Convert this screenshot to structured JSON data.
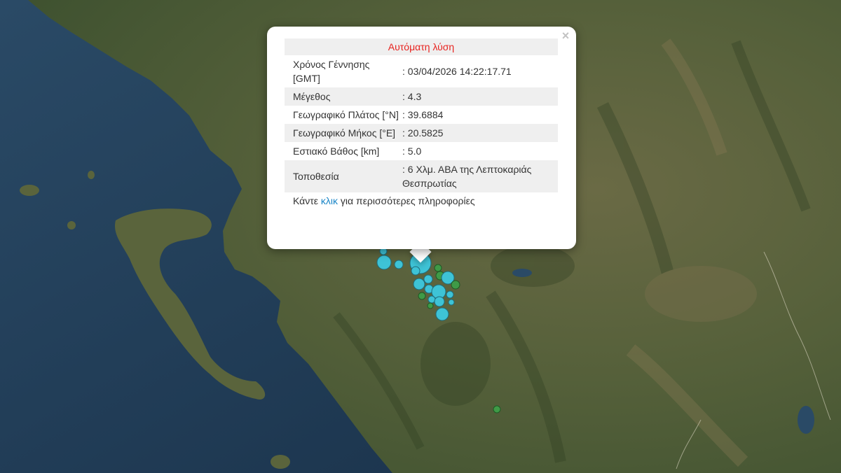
{
  "popup": {
    "close_symbol": "×",
    "title": "Αυτόματη λύση",
    "rows": [
      {
        "label": "Χρόνος Γέννησης [GMT]",
        "value": ": 03/04/2026 14:22:17.71"
      },
      {
        "label": "Μέγεθος",
        "value": ": 4.3"
      },
      {
        "label": "Γεωγραφικό Πλάτος [°N]",
        "value": ": 39.6884"
      },
      {
        "label": "Γεωγραφικό Μήκος [°E]",
        "value": ": 20.5825"
      },
      {
        "label": "Εστιακό Βάθος [km]",
        "value": ": 5.0"
      },
      {
        "label": "Τοποθεσία",
        "value": ": 6 Χλμ. ΑΒΑ της Λεπτοκαριάς Θεσπρωτίας"
      }
    ],
    "more_prefix": "Κάντε ",
    "more_link": "κλικ",
    "more_suffix": " για περισσότερες πληροφορίες"
  },
  "colors": {
    "sea": "#1f3a55",
    "land": "#56603c",
    "quake_recent": "#3ec3d6",
    "quake_older": "#3f9a47",
    "title_red": "#e8231f",
    "link_blue": "#1a86c7"
  }
}
